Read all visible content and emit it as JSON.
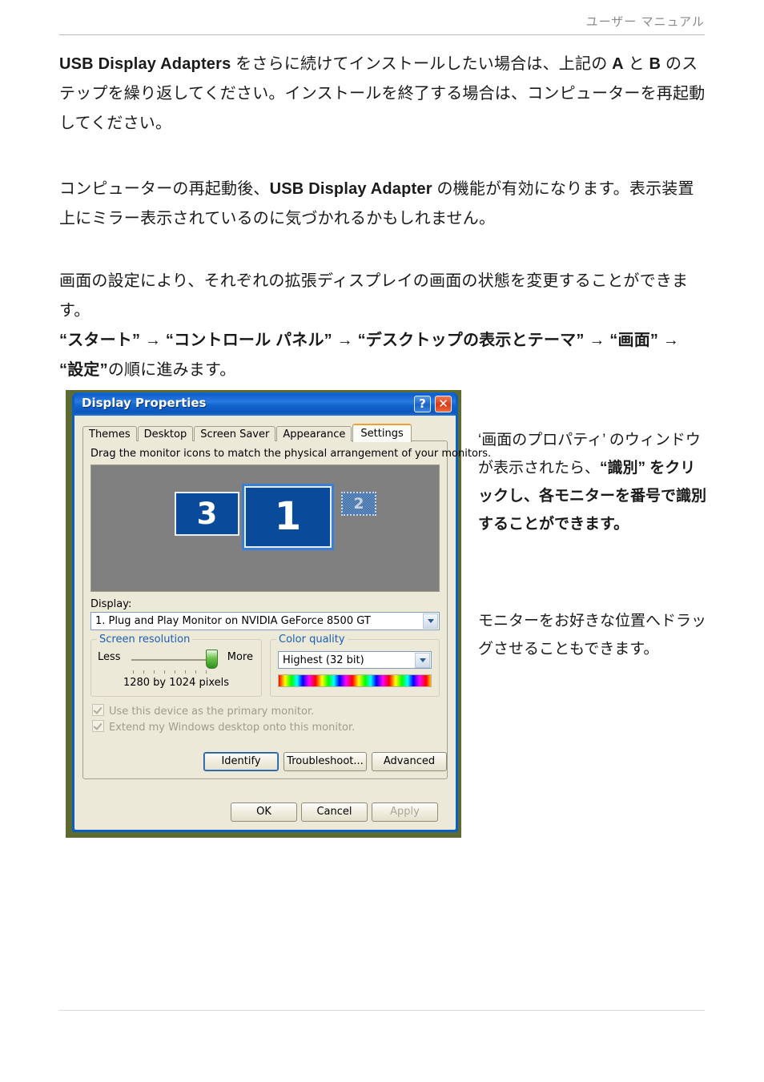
{
  "header": {
    "text": "ユーザー マニュアル"
  },
  "paragraphs": {
    "p1_bold_lead": "USB Display Adapters",
    "p1_rest": " をさらに続けてインストールしたい場合は、上記の ",
    "p1_bold_a": "A",
    "p1_mid": " と ",
    "p1_bold_b": "B",
    "p1_tail": " のステップを繰り返してください。インストールを終了する場合は、コンピューターを再起動してください。",
    "p2_lead": "コンピューターの再起動後、",
    "p2_bold": "USB Display Adapter",
    "p2_tail": " の機能が有効になります。表示装置上にミラー表示されているのに気づかれるかもしれません。",
    "p3": "画面の設定により、それぞれの拡張ディスプレイの画面の状態を変更することができます。",
    "p4_path": "“スタート” → “コントロール パネル” → “デスクトップの表示とテーマ” → “画面” → “設定”",
    "p4_tail": "の順に進みます。"
  },
  "sidebar": {
    "s1_light": "‘画面のプロパティ’ のウィンドウが表示されたら、",
    "s1_bold": "“識別” をクリックし、各モニターを番号で識別することができます。",
    "s2": "モニターをお好きな位置へドラッグさせることもできます。"
  },
  "dialog": {
    "title": "Display Properties",
    "help_button": "?",
    "close_button": "✕",
    "tabs": [
      {
        "label": "Themes",
        "active": false
      },
      {
        "label": "Desktop",
        "active": false
      },
      {
        "label": "Screen Saver",
        "active": false
      },
      {
        "label": "Appearance",
        "active": false
      },
      {
        "label": "Settings",
        "active": true
      }
    ],
    "drag_hint": "Drag the monitor icons to match the physical arrangement of your monitors.",
    "monitors": [
      {
        "number": "3",
        "state": "enabled"
      },
      {
        "number": "1",
        "state": "selected"
      },
      {
        "number": "2",
        "state": "disabled"
      }
    ],
    "display_label": "Display:",
    "display_value": "1. Plug and Play Monitor on NVIDIA GeForce 8500 GT",
    "screen_resolution": {
      "group_title": "Screen resolution",
      "less_label": "Less",
      "more_label": "More",
      "value": "1280 by 1024 pixels"
    },
    "color_quality": {
      "group_title": "Color quality",
      "value": "Highest (32 bit)"
    },
    "checkboxes": [
      {
        "label": "Use this device as the primary monitor.",
        "checked": true,
        "enabled": false
      },
      {
        "label": "Extend my Windows desktop onto this monitor.",
        "checked": true,
        "enabled": false
      }
    ],
    "buttons": {
      "identify": "Identify",
      "troubleshoot": "Troubleshoot...",
      "advanced": "Advanced",
      "ok": "OK",
      "cancel": "Cancel",
      "apply": "Apply"
    }
  },
  "colors": {
    "titlebar_blue": "#0a5fc4",
    "dialog_face": "#ece9d8",
    "group_title_blue": "#1a5fb4",
    "monitor_blue": "#0a4a9a",
    "desktop_olive": "#5d6b33",
    "header_gray": "#8a8a8a",
    "slider_green": "#6cc24a"
  }
}
